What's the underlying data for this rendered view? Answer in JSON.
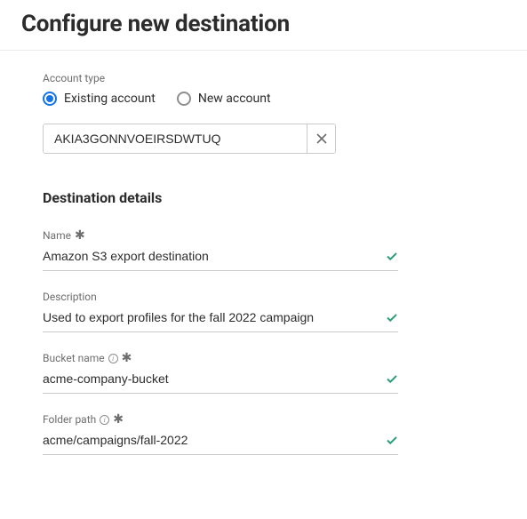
{
  "header": {
    "title": "Configure new destination"
  },
  "account": {
    "label": "Account type",
    "options": {
      "existing": "Existing account",
      "new": "New account"
    },
    "selected_value": "AKIA3GONNVOEIRSDWTUQ"
  },
  "details": {
    "title": "Destination details",
    "fields": {
      "name": {
        "label": "Name",
        "value": "Amazon S3 export destination",
        "required": true,
        "info": false,
        "valid": true
      },
      "description": {
        "label": "Description",
        "value": "Used to export profiles for the fall 2022 campaign",
        "required": false,
        "info": false,
        "valid": true
      },
      "bucket": {
        "label": "Bucket name",
        "value": "acme-company-bucket",
        "required": true,
        "info": true,
        "valid": true
      },
      "folder": {
        "label": "Folder path",
        "value": "acme/campaigns/fall-2022",
        "required": true,
        "info": true,
        "valid": true
      }
    }
  }
}
